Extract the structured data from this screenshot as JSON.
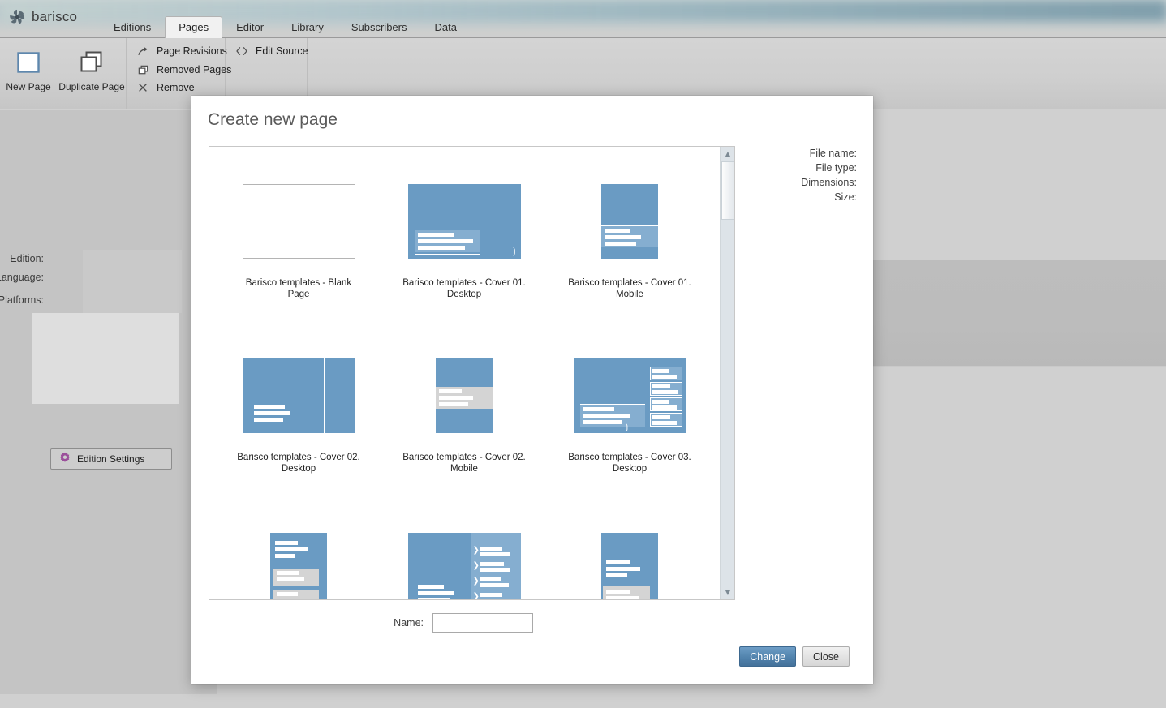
{
  "app": {
    "brand": "barisco",
    "brand_icon": "pinwheel-logo-icon",
    "tabs": [
      {
        "label": "Editions",
        "active": false
      },
      {
        "label": "Pages",
        "active": true
      },
      {
        "label": "Editor",
        "active": false
      },
      {
        "label": "Library",
        "active": false
      },
      {
        "label": "Subscribers",
        "active": false
      },
      {
        "label": "Data",
        "active": false
      }
    ]
  },
  "ribbon": {
    "big_buttons": [
      {
        "label": "New Page",
        "icon": "rectangle-outline-icon"
      },
      {
        "label": "Duplicate Page",
        "icon": "copy-pages-icon"
      }
    ],
    "manage_items": [
      {
        "label": "Page Revisions",
        "icon": "arrow-curve-icon"
      },
      {
        "label": "Removed Pages",
        "icon": "copy-pages-icon"
      },
      {
        "label": "Remove",
        "icon": "close-x-icon"
      }
    ],
    "source_items": [
      {
        "label": "Edit Source",
        "icon": "code-brackets-icon"
      }
    ]
  },
  "left_panel": {
    "fields": [
      {
        "label": "Edition:"
      },
      {
        "label": "Language:"
      },
      {
        "label": "Platforms:"
      }
    ],
    "edition_settings": {
      "label": "Edition Settings",
      "icon": "gear-icon",
      "icon_color": "#9b4f9b"
    }
  },
  "modal": {
    "title": "Create new page",
    "info": [
      {
        "label": "File name:",
        "value": ""
      },
      {
        "label": "File type:",
        "value": ""
      },
      {
        "label": "Dimensions:",
        "value": ""
      },
      {
        "label": "Size:",
        "value": ""
      }
    ],
    "name_field": {
      "label": "Name:",
      "value": "",
      "placeholder": ""
    },
    "buttons": [
      {
        "label": "Change",
        "style": "primary"
      },
      {
        "label": "Close",
        "style": "secondary"
      }
    ],
    "scrollbar": {
      "up_glyph": "▲",
      "down_glyph": "▼",
      "position": "top"
    },
    "templates": [
      {
        "caption": "Barisco templates - Blank Page",
        "kind": "blank",
        "selected": false
      },
      {
        "caption": "Barisco templates - Cover 01. Desktop",
        "kind": "cover01-desktop",
        "selected": false
      },
      {
        "caption": "Barisco templates - Cover 01. Mobile",
        "kind": "cover01-mobile",
        "selected": false
      },
      {
        "caption": "Barisco templates - Cover 02. Desktop",
        "kind": "cover02-desktop",
        "selected": false
      },
      {
        "caption": "Barisco templates - Cover 02. Mobile",
        "kind": "cover02-mobile",
        "selected": false
      },
      {
        "caption": "Barisco templates - Cover 03. Desktop",
        "kind": "cover03-desktop",
        "selected": false
      },
      {
        "caption": "",
        "kind": "row3-mobile-a",
        "selected": false
      },
      {
        "caption": "",
        "kind": "row3-desktop-b",
        "selected": false
      },
      {
        "caption": "",
        "kind": "row3-mobile-c",
        "selected": false
      }
    ]
  },
  "colors": {
    "template_blue": "#6a9bc3",
    "template_blue_light": "#85aed0",
    "accent_button": "#5183ad",
    "chrome_gray": "#d0d0d0"
  }
}
